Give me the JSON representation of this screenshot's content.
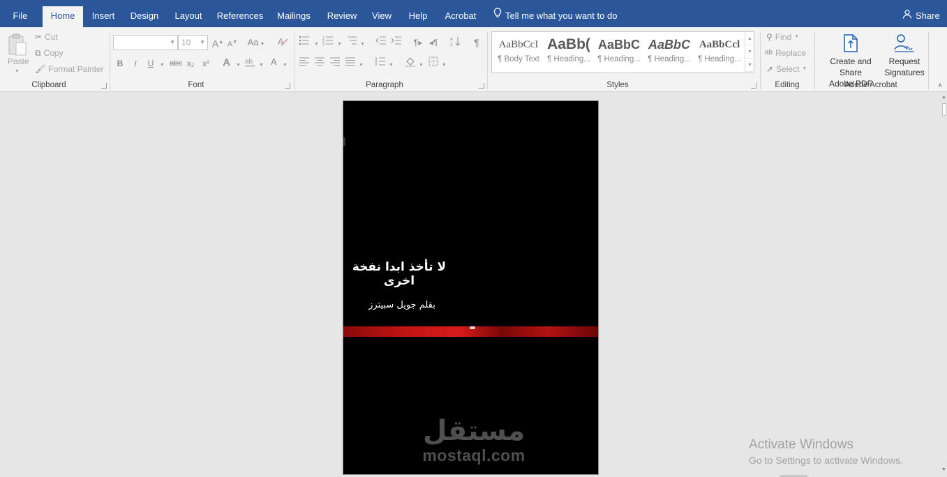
{
  "menu": {
    "tabs": [
      "File",
      "Home",
      "Insert",
      "Design",
      "Layout",
      "References",
      "Mailings",
      "Review",
      "View",
      "Help",
      "Acrobat"
    ],
    "active_tab": "Home",
    "tell_me": "Tell me what you want to do",
    "share": "Share"
  },
  "clipboard": {
    "paste": "Paste",
    "cut": "Cut",
    "copy": "Copy",
    "format_painter": "Format Painter",
    "label": "Clipboard"
  },
  "font": {
    "family_value": "",
    "size_value": "10",
    "label": "Font",
    "buttons": {
      "bold": "B",
      "italic": "I",
      "underline": "U",
      "strikethrough": "abc",
      "subscript": "x₂",
      "superscript": "x²",
      "grow": "A",
      "shrink": "A",
      "change_case": "Aa"
    }
  },
  "paragraph": {
    "label": "Paragraph"
  },
  "styles": {
    "label": "Styles",
    "items": [
      {
        "sample": "AaBbCcI",
        "name": "¶ Body Text"
      },
      {
        "sample": "AaBb(",
        "name": "¶ Heading..."
      },
      {
        "sample": "AaBbC",
        "name": "¶ Heading..."
      },
      {
        "sample": "AaBbC",
        "name": "¶ Heading..."
      },
      {
        "sample": "AaBbCcl",
        "name": "¶ Heading..."
      }
    ]
  },
  "editing": {
    "find": "Find",
    "replace": "Replace",
    "select": "Select",
    "label": "Editing"
  },
  "acrobat": {
    "create_share_line1": "Create and Share",
    "create_share_line2": "Adobe PDF",
    "request_line1": "Request",
    "request_line2": "Signatures",
    "label": "Adobe Acrobat"
  },
  "document": {
    "title": "لا تأخذ ابدا نفخة اخرى",
    "author": "بقلم جويل سبيترز"
  },
  "watermark": {
    "arabic": "مستقل",
    "latin": "mostaql.com"
  },
  "activation": {
    "line1": "Activate Windows",
    "line2": "Go to Settings to activate Windows."
  },
  "colors": {
    "menubar": "#2b579a",
    "ribbon": "#f3f3f3",
    "canvas": "#e6e6e6",
    "acrobat_blue": "#1a5fb4"
  }
}
